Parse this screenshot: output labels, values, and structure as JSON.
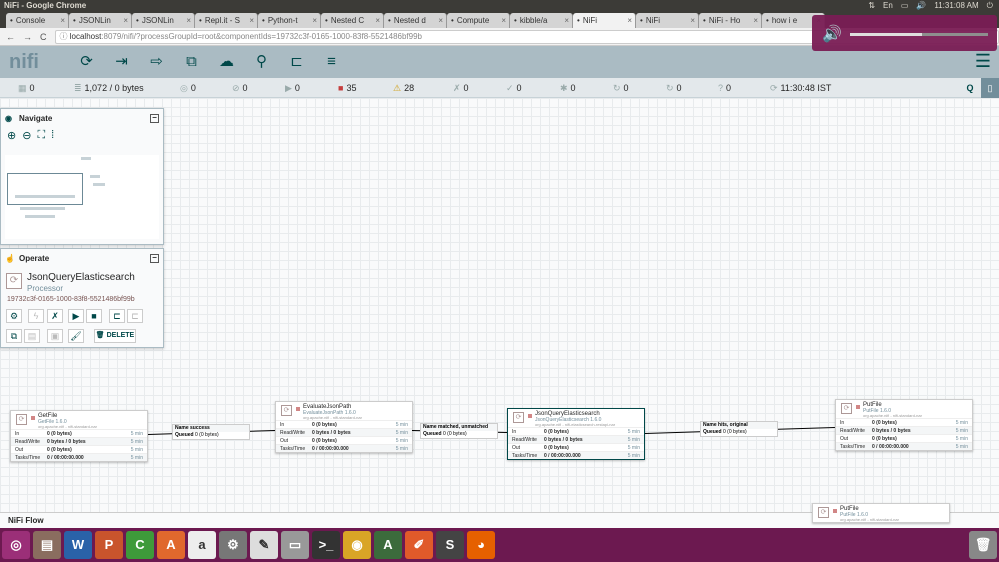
{
  "window": {
    "title": "NiFi - Google Chrome"
  },
  "system": {
    "keyboard": "En",
    "clock": "11:31:08 AM",
    "volume_percent": 52
  },
  "tabs": [
    {
      "label": "Console",
      "icon": "k"
    },
    {
      "label": "JSONLin",
      "icon": "doc"
    },
    {
      "label": "JSONLin",
      "icon": "doc"
    },
    {
      "label": "Repl.it - S",
      "icon": "r"
    },
    {
      "label": "Python-t",
      "icon": "gh"
    },
    {
      "label": "Nested C",
      "icon": "n"
    },
    {
      "label": "Nested d",
      "icon": "n"
    },
    {
      "label": "Compute",
      "icon": "D"
    },
    {
      "label": "kibble/a",
      "icon": "gh"
    },
    {
      "label": "NiFi",
      "icon": "drop",
      "active": true
    },
    {
      "label": "NiFi",
      "icon": "drop"
    },
    {
      "label": "NiFi - Ho",
      "icon": "h"
    },
    {
      "label": "how i e",
      "icon": "h"
    }
  ],
  "address": {
    "host": "localhost",
    "path": ":8079/nifi/?processGroupId=root&componentIds=19732c3f-0165-1000-83f8-5521486bf99b"
  },
  "nifi": {
    "logo": "nifi"
  },
  "status": [
    {
      "icon": "cluster-icon",
      "value": "0"
    },
    {
      "icon": "queue-icon",
      "value": "1,072 / 0 bytes"
    },
    {
      "icon": "transmitting-icon",
      "value": "0"
    },
    {
      "icon": "not-transmitting-icon",
      "value": "0"
    },
    {
      "icon": "running-icon",
      "value": "0"
    },
    {
      "icon": "stopped-icon",
      "value": "35"
    },
    {
      "icon": "invalid-icon",
      "value": "28"
    },
    {
      "icon": "disabled-icon",
      "value": "0"
    },
    {
      "icon": "up-to-date-icon",
      "value": "0"
    },
    {
      "icon": "locally-modified-icon",
      "value": "0"
    },
    {
      "icon": "stale-icon",
      "value": "0"
    },
    {
      "icon": "modified-stale-icon",
      "value": "0"
    },
    {
      "icon": "sync-failure-icon",
      "value": "0"
    },
    {
      "icon": "refresh-icon",
      "value": "11:30:48 IST"
    }
  ],
  "navigate": {
    "title": "Navigate"
  },
  "operate": {
    "title": "Operate",
    "name": "JsonQueryElasticsearch",
    "type": "Processor",
    "id": "19732c3f-0165-1000-83f8-5521486bf99b",
    "delete": "DELETE"
  },
  "processors": [
    {
      "name": "GetFile",
      "version": "GetFile 1.6.0",
      "bundle": "org.apache.nifi - nifi-standard-nar",
      "in": "0 (0 bytes)",
      "rw": "0 bytes / 0 bytes",
      "out": "0 (0 bytes)",
      "tasks": "0 / 00:00:00.000",
      "window": "5 min"
    },
    {
      "name": "EvaluateJsonPath",
      "version": "EvaluateJsonPath 1.6.0",
      "bundle": "org.apache.nifi - nifi-standard-nar",
      "in": "0 (0 bytes)",
      "rw": "0 bytes / 0 bytes",
      "out": "0 (0 bytes)",
      "tasks": "0 / 00:00:00.000",
      "window": "5 min"
    },
    {
      "name": "JsonQueryElasticsearch",
      "version": "JsonQueryElasticsearch 1.6.0",
      "bundle": "org.apache.nifi - nifi-elasticsearch-restapi-nar",
      "in": "0 (0 bytes)",
      "rw": "0 bytes / 0 bytes",
      "out": "0 (0 bytes)",
      "tasks": "0 / 00:00:00.000",
      "window": "5 min"
    },
    {
      "name": "PutFile",
      "version": "PutFile 1.6.0",
      "bundle": "org.apache.nifi - nifi-standard-nar",
      "in": "0 (0 bytes)",
      "rw": "0 bytes / 0 bytes",
      "out": "0 (0 bytes)",
      "tasks": "0 / 00:00:00.000",
      "window": "5 min"
    },
    {
      "name": "PutFile",
      "version": "PutFile 1.6.0",
      "bundle": "org.apache.nifi - nifi-standard-nar",
      "in": "",
      "rw": "",
      "out": "",
      "tasks": "",
      "window": ""
    }
  ],
  "row_labels": {
    "in": "In",
    "rw": "Read/Write",
    "out": "Out",
    "tasks": "Tasks/Time"
  },
  "connections": [
    {
      "name": "success",
      "queued": "0 (0 bytes)"
    },
    {
      "name": "matched, unmatched",
      "queued": "0 (0 bytes)"
    },
    {
      "name": "hits, original",
      "queued": "0 (0 bytes)"
    }
  ],
  "conn_labels": {
    "name": "Name",
    "queued": "Queued"
  },
  "footer": {
    "breadcrumb": "NiFi Flow"
  },
  "dock": [
    {
      "name": "ubuntu-icon",
      "color": "#9b2f78",
      "g": "◎"
    },
    {
      "name": "files-icon",
      "color": "#8a6d5f",
      "g": "▤"
    },
    {
      "name": "writer-icon",
      "color": "#2a62a8",
      "g": "W"
    },
    {
      "name": "impress-icon",
      "color": "#c9542c",
      "g": "P"
    },
    {
      "name": "calc-icon",
      "color": "#3e9a3a",
      "g": "C"
    },
    {
      "name": "software-center-icon",
      "color": "#e0682d",
      "g": "A"
    },
    {
      "name": "amazon-icon",
      "color": "#eeeeee",
      "g": "a"
    },
    {
      "name": "settings-icon",
      "color": "#777777",
      "g": "⚙"
    },
    {
      "name": "text-editor-icon",
      "color": "#dddddd",
      "g": "✎"
    },
    {
      "name": "disk-icon",
      "color": "#999999",
      "g": "▭"
    },
    {
      "name": "terminal-icon",
      "color": "#333333",
      "g": ">_"
    },
    {
      "name": "chrome-icon",
      "color": "#d9a526",
      "g": "◉"
    },
    {
      "name": "atom-icon",
      "color": "#3c6b3c",
      "g": "A"
    },
    {
      "name": "editor-icon",
      "color": "#e05a2a",
      "g": "✐"
    },
    {
      "name": "sublime-icon",
      "color": "#444444",
      "g": "S"
    },
    {
      "name": "firefox-icon",
      "color": "#e66000",
      "g": "◕"
    }
  ],
  "trash": {
    "name": "trash-icon"
  }
}
